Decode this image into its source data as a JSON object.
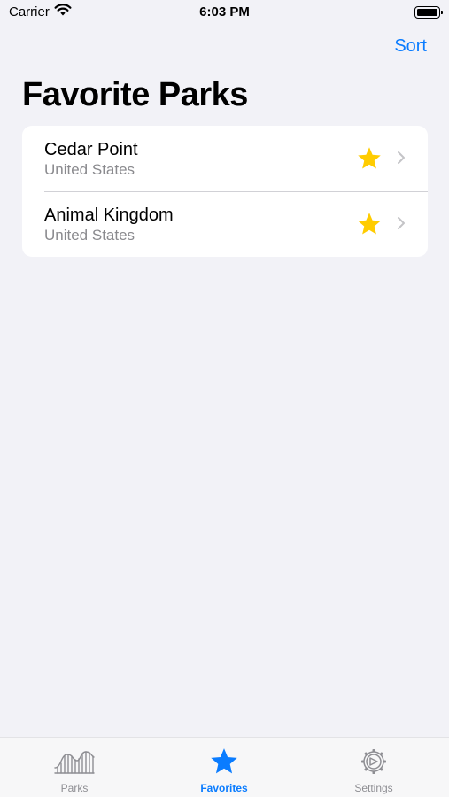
{
  "status_bar": {
    "carrier": "Carrier",
    "time": "6:03 PM"
  },
  "nav": {
    "sort_label": "Sort",
    "title": "Favorite Parks"
  },
  "parks": [
    {
      "name": "Cedar Point",
      "country": "United States",
      "favorite": true
    },
    {
      "name": "Animal Kingdom",
      "country": "United States",
      "favorite": true
    }
  ],
  "tab_bar": {
    "tabs": [
      {
        "label": "Parks",
        "icon": "roller-coaster-icon",
        "active": false
      },
      {
        "label": "Favorites",
        "icon": "star-icon",
        "active": true
      },
      {
        "label": "Settings",
        "icon": "gear-icon",
        "active": false
      }
    ]
  },
  "colors": {
    "accent": "#0a7cff",
    "star": "#ffcc00",
    "background": "#f2f2f7",
    "secondary_text": "#8a8a8e"
  }
}
